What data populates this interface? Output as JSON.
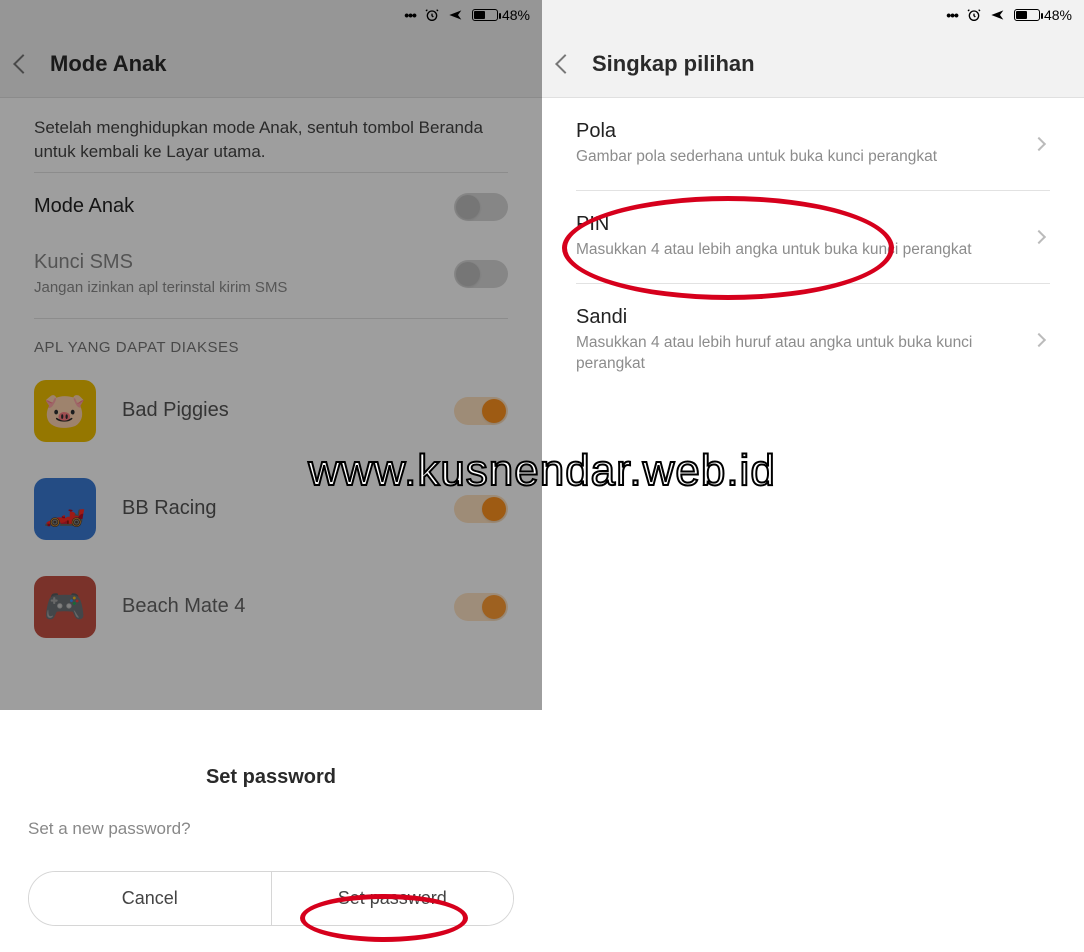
{
  "statusbar": {
    "battery_pct": "48%"
  },
  "left": {
    "header_title": "Mode Anak",
    "intro": "Setelah menghidupkan mode Anak, sentuh tombol Beranda untuk kembali ke Layar utama.",
    "mode_anak_label": "Mode Anak",
    "kunci_sms_label": "Kunci SMS",
    "kunci_sms_sub": "Jangan izinkan apl terinstal kirim SMS",
    "section_apps": "APL YANG DAPAT DIAKSES",
    "apps": [
      {
        "name": "Bad Piggies"
      },
      {
        "name": "BB Racing"
      },
      {
        "name": "Beach Mate 4"
      }
    ],
    "sheet": {
      "title": "Set password",
      "msg": "Set a new password?",
      "cancel": "Cancel",
      "confirm": "Set password"
    }
  },
  "right": {
    "header_title": "Singkap pilihan",
    "options": [
      {
        "title": "Pola",
        "sub": "Gambar pola sederhana untuk buka kunci perangkat"
      },
      {
        "title": "PIN",
        "sub": "Masukkan 4 atau lebih angka untuk buka kunci perangkat"
      },
      {
        "title": "Sandi",
        "sub": "Masukkan 4 atau lebih huruf atau angka untuk buka kunci perangkat"
      }
    ]
  },
  "watermark": "www.kusnendar.web.id"
}
